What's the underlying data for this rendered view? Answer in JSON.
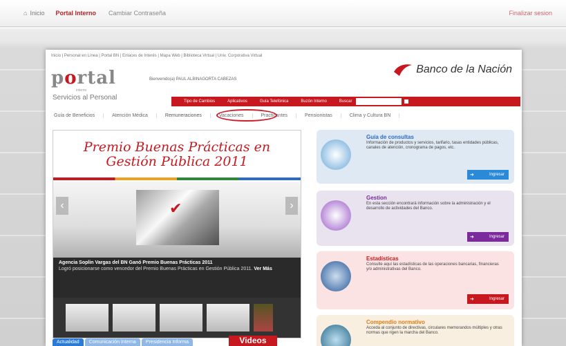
{
  "topbar": {
    "home": "Inicio",
    "portal": "Portal Interno",
    "change_password": "Cambiar Contraseña",
    "logout": "Finalizar sesion"
  },
  "breadcrumb": "Inicio | Personal en Línea | Portal BN | Enlaces de Interés | Mapa Web | Biblioteca Virtual | Univ. Corporativa Virtual",
  "logo": {
    "text": "portal",
    "sub": "interno"
  },
  "section": "Servicios al Personal",
  "welcome": "Bienvenido(a) PAUL ALBINAGORTA CABEZAS",
  "bank_name": "Banco de la Nación",
  "redbar": [
    "Tipo de Cambios",
    "Aplicativos",
    "Guía Telefónica",
    "Buzón Interno",
    "Buscar"
  ],
  "submenu": [
    "Guía de Beneficios",
    "Atención Médica",
    "Remuneraciones",
    "Vacaciones",
    "Practicantes",
    "Pensionistas",
    "Clima y Cultura BN"
  ],
  "slider": {
    "title_line1": "Premio Buenas Prácticas en",
    "title_line2": "Gestión Pública 2011",
    "headline": "Agencia Soplin Vargas del BN Ganó Premio Buenas Prácticas 2011",
    "body": "Logró posicionarse como vencedor del Premio Buenas Prácticas en Gestión Pública 2011.",
    "more": "Ver Más"
  },
  "tabs": [
    "Actualidad",
    "Comunicación Interna",
    "Presidencia Informa"
  ],
  "videos": "Videos",
  "cards": [
    {
      "title": "Guía de consultas",
      "desc": "Información de productos y servicios, tarifario, tasas entidades públicas, canales de atención, cronograma de pagos, etc.",
      "button": "Ingresar"
    },
    {
      "title": "Gestion",
      "desc": "En esta sección encontrará información sobre la administración y el desarrollo de actividades del Banco.",
      "button": "Ingresar"
    },
    {
      "title": "Estadísticas",
      "desc": "Consulte aquí las estadísticas de las operaciones bancarias, financieras y/o administrativas del Banco.",
      "button": "Ingresar"
    },
    {
      "title": "Compendio normativo",
      "desc": "Acceda al conjunto de directivas, circulares memorandos múltiples y otras normas que rigen la marcha del Banco."
    }
  ]
}
